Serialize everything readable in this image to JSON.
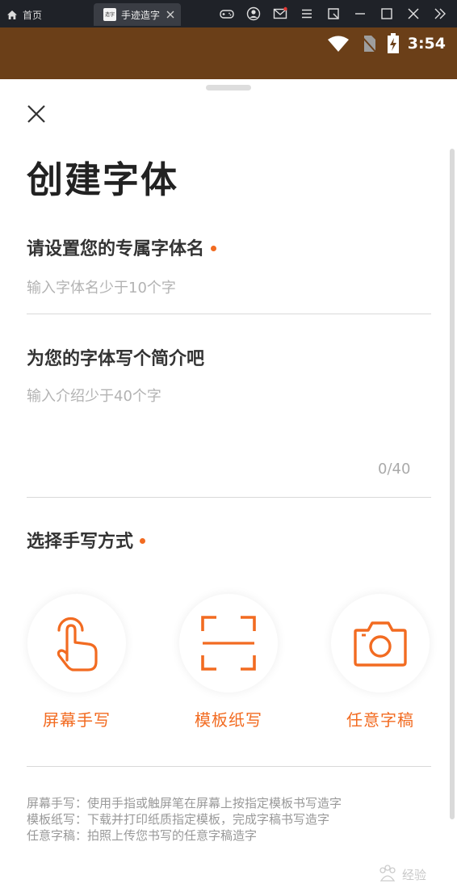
{
  "emulator": {
    "home_tab_label": "首页",
    "active_tab_label": "手迹造字",
    "app_icon_text": "造字"
  },
  "status_bar": {
    "time": "3:54"
  },
  "sheet": {
    "title": "创建字体",
    "name_section": {
      "label": "请设置您的专属字体名",
      "placeholder": "输入字体名少于10个字",
      "value": ""
    },
    "intro_section": {
      "label": "为您的字体写个简介吧",
      "placeholder": "输入介绍少于40个字",
      "value": "",
      "counter": "0/40"
    },
    "method_section": {
      "label": "选择手写方式",
      "methods": [
        {
          "label": "屏幕手写",
          "icon": "touch-hand-icon"
        },
        {
          "label": "模板纸写",
          "icon": "scan-frame-icon"
        },
        {
          "label": "任意字稿",
          "icon": "camera-icon"
        }
      ]
    },
    "footnote_lines": [
      "屏幕手写：使用手指或触屏笔在屏幕上按指定模板书写造字",
      "模板纸写：下载并打印纸质指定模板，完成字稿书写造字",
      "任意字稿：拍照上传您书写的任意字稿造字"
    ],
    "watermark_text": "经验"
  },
  "colors": {
    "accent": "#f26b21",
    "status_bar_bg": "#6b3f18",
    "emulator_bar_bg": "#1f2228"
  }
}
